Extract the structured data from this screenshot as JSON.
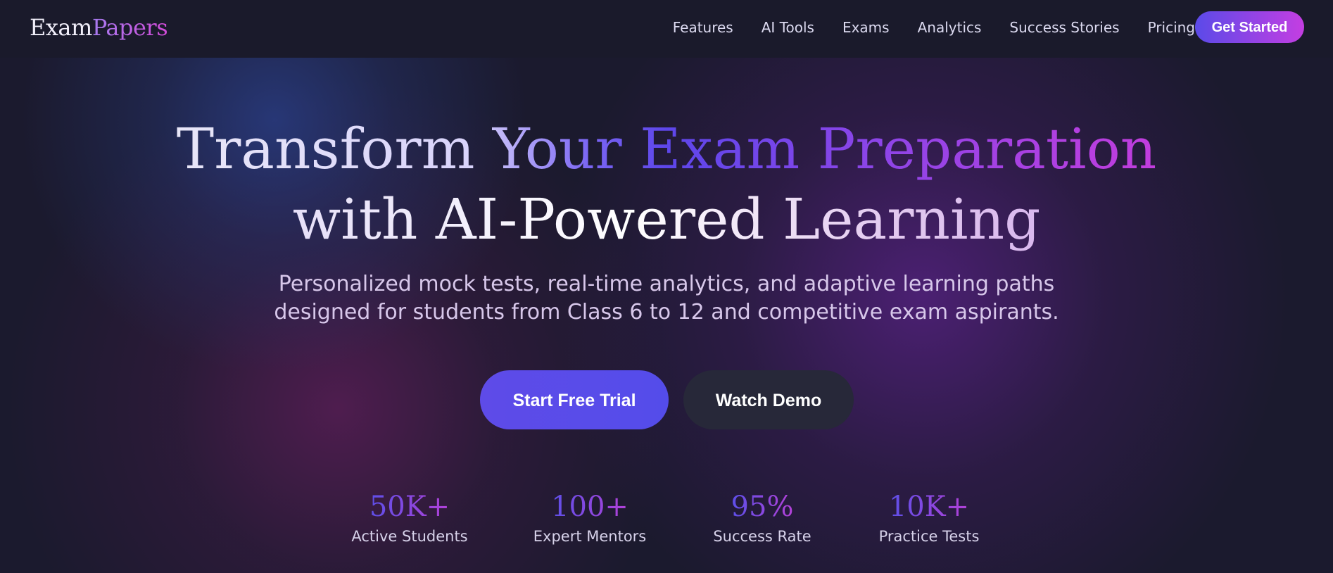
{
  "header": {
    "logo": {
      "part1": "Exam",
      "part2": "Papers"
    },
    "nav": [
      "Features",
      "AI Tools",
      "Exams",
      "Analytics",
      "Success Stories",
      "Pricing"
    ],
    "cta_label": "Get Started"
  },
  "hero": {
    "title_line1": "Transform Your Exam Preparation",
    "title_line2": "with AI-Powered Learning",
    "subtitle_line1": "Personalized mock tests, real-time analytics, and adaptive learning paths",
    "subtitle_line2": "designed for students from Class 6 to 12 and competitive exam aspirants.",
    "primary_button": "Start Free Trial",
    "secondary_button": "Watch Demo"
  },
  "stats": [
    {
      "value": "50K+",
      "label": "Active Students"
    },
    {
      "value": "100+",
      "label": "Expert Mentors"
    },
    {
      "value": "95%",
      "label": "Success Rate"
    },
    {
      "value": "10K+",
      "label": "Practice Tests"
    }
  ],
  "colors": {
    "background": "#1b1a2e",
    "accent_start": "#5b4ae8",
    "accent_end": "#c43ee2"
  }
}
